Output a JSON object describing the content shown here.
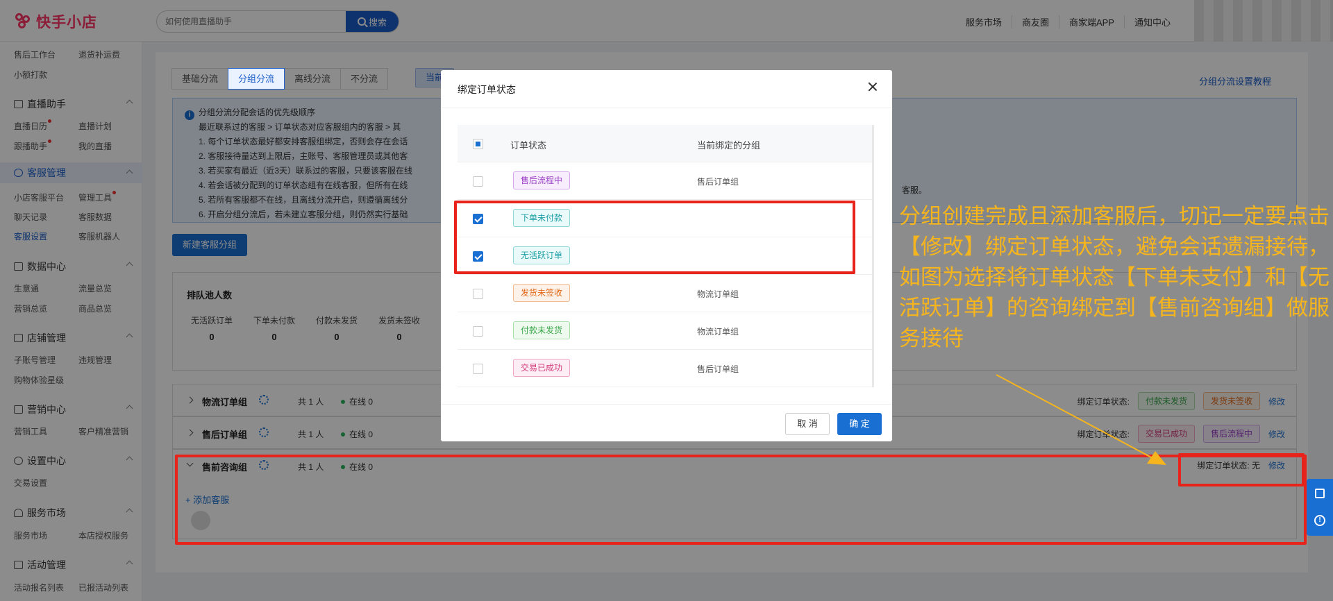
{
  "header": {
    "logo_text": "快手小店",
    "search_placeholder": "如何使用直播助手",
    "search_button": "搜索",
    "nav": [
      "服务市场",
      "商友圈",
      "商家端APP",
      "通知中心"
    ]
  },
  "sidebar": {
    "rows": [
      [
        "售后工作台",
        "退货补运费"
      ],
      [
        "小额打款"
      ]
    ],
    "sections": [
      {
        "title": "直播助手",
        "rows": [
          [
            "直播日历",
            "直播计划"
          ],
          [
            "跟播助手",
            "我的直播"
          ]
        ]
      },
      {
        "title": "客服管理",
        "rows": [
          [
            "小店客服平台",
            "管理工具"
          ],
          [
            "聊天记录",
            "客服数据"
          ],
          [
            "客服设置",
            "客服机器人"
          ]
        ]
      },
      {
        "title": "数据中心",
        "rows": [
          [
            "生意通",
            "流量总览"
          ],
          [
            "营销总览",
            "商品总览"
          ]
        ]
      },
      {
        "title": "店铺管理",
        "rows": [
          [
            "子账号管理",
            "违规管理"
          ],
          [
            "购物体验星级"
          ]
        ]
      },
      {
        "title": "营销中心",
        "rows": [
          [
            "营销工具",
            "客户精准营销"
          ]
        ]
      },
      {
        "title": "设置中心",
        "rows": [
          [
            "交易设置"
          ]
        ]
      },
      {
        "title": "服务市场",
        "rows": [
          [
            "服务市场",
            "本店授权服务"
          ]
        ]
      },
      {
        "title": "活动管理",
        "rows": [
          [
            "活动报名列表",
            "已报活动列表"
          ]
        ]
      }
    ]
  },
  "main": {
    "tabs": [
      "基础分流",
      "分组分流",
      "离线分流",
      "不分流"
    ],
    "tab_extra": "当前",
    "tutorial_link": "分组分流设置教程",
    "notice": {
      "title": "分组分流分配会话的优先级顺序",
      "lines": [
        "最近联系过的客服 > 订单状态对应客服组内的客服 > 其",
        "1. 每个订单状态最好都安排客服组绑定，否则会存在会话",
        "2. 客服接待量达到上限后，主账号、客服管理员或其他客",
        "3. 若买家有最近（近3天）联系过的客服，只要该客服在线",
        "4. 若会话被分配到的订单状态组有在线客服，但所有在线",
        "5. 若所有客服都不在线，且离线分流开启，则遵循离线分",
        "6. 开启分组分流后，若未建立客服分组，则仍然实行基础"
      ],
      "tail": "客服。"
    },
    "new_group_button": "新建客服分组",
    "queue": {
      "title": "排队池人数",
      "items": [
        {
          "label": "无活跃订单",
          "value": "0"
        },
        {
          "label": "下单未付款",
          "value": "0"
        },
        {
          "label": "付款未发货",
          "value": "0"
        },
        {
          "label": "发货未签收",
          "value": "0"
        }
      ]
    },
    "groups": [
      {
        "name": "物流订单组",
        "count": "共 1 人",
        "online": "在线 0",
        "bind_label": "绑定订单状态:",
        "tags": [
          "付款未发货",
          "发货未签收"
        ],
        "edit": "修改"
      },
      {
        "name": "售后订单组",
        "count": "共 1 人",
        "online": "在线 0",
        "bind_label": "绑定订单状态:",
        "tags": [
          "交易已成功",
          "售后流程中"
        ],
        "edit": "修改"
      },
      {
        "name": "售前咨询组",
        "count": "共 1 人",
        "online": "在线 0",
        "bind_label": "绑定订单状态: 无",
        "edit": "修改",
        "add_cs": "+ 添加客服"
      }
    ]
  },
  "modal": {
    "title": "绑定订单状态",
    "col_status": "订单状态",
    "col_group": "当前绑定的分组",
    "rows": [
      {
        "status": "售后流程中",
        "group": "售后订单组",
        "checked": false
      },
      {
        "status": "下单未付款",
        "group": "",
        "checked": true
      },
      {
        "status": "无活跃订单",
        "group": "",
        "checked": true
      },
      {
        "status": "发货未签收",
        "group": "物流订单组",
        "checked": false
      },
      {
        "status": "付款未发货",
        "group": "物流订单组",
        "checked": false
      },
      {
        "status": "交易已成功",
        "group": "售后订单组",
        "checked": false
      }
    ],
    "cancel": "取 消",
    "ok": "确 定"
  },
  "annotation": {
    "text": "分组创建完成且添加客服后，切记一定要点击【修改】绑定订单状态，避免会话遗漏接待，如图为选择将订单状态【下单未支付】和【无活跃订单】的咨询绑定到【售前咨询组】做服务接待",
    "color": "#f6b51d",
    "box_color": "#e8231c"
  }
}
